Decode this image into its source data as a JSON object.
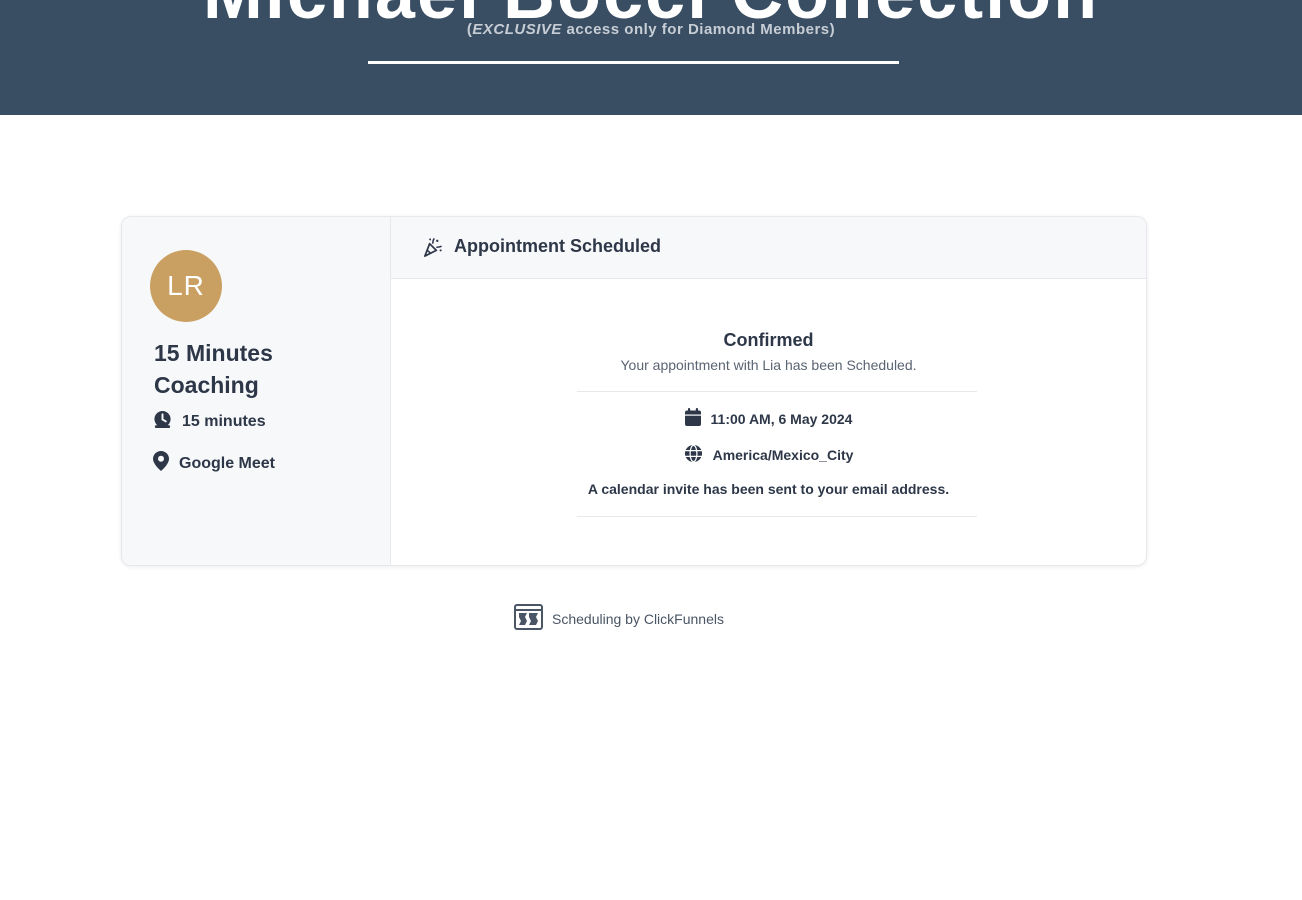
{
  "banner": {
    "title": "Michael Bocci Collection",
    "subtitle_open": "(",
    "subtitle_exclusive": "EXCLUSIVE",
    "subtitle_rest": " access only for Diamond Members)"
  },
  "event": {
    "avatar_initials": "LR",
    "avatar_color": "#c9a062",
    "title": "15 Minutes Coaching",
    "duration": "15 minutes",
    "duration_icon": "clock-icon",
    "location": "Google Meet",
    "location_icon": "map-pin-icon"
  },
  "confirmation": {
    "header_icon": "party-popper-icon",
    "header_title": "Appointment Scheduled",
    "status": "Confirmed",
    "message": "Your appointment with Lia has been Scheduled.",
    "datetime": "11:00 AM, 6 May 2024",
    "datetime_icon": "calendar-icon",
    "timezone": "America/Mexico_City",
    "timezone_icon": "globe-icon",
    "invite_note": "A calendar invite has been sent to your email address."
  },
  "footer": {
    "logo_icon": "clickfunnels-logo-icon",
    "text": "Scheduling by ClickFunnels"
  },
  "colors": {
    "banner_bg": "#3a4e63",
    "text_dark": "#2d3748",
    "panel_bg": "#f7f8fa"
  }
}
